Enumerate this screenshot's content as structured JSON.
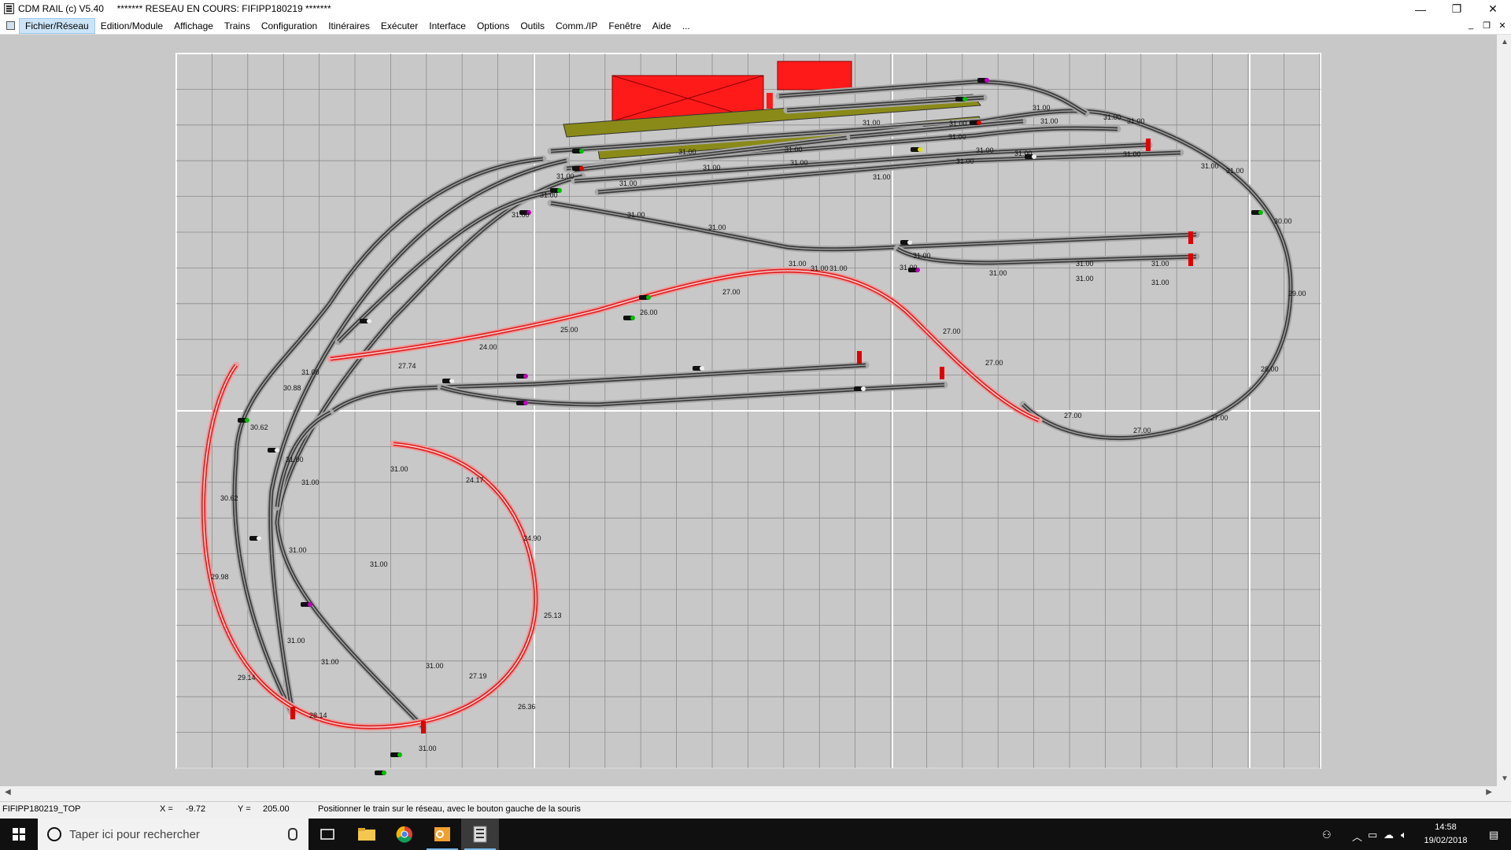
{
  "window": {
    "title": "CDM RAIL (c) V5.40     ******* RESEAU EN COURS: FIFIPP180219 *******",
    "minimize_icon": "minimize-icon",
    "restore_icon": "restore-icon",
    "close_icon": "close-icon"
  },
  "menu": {
    "items": [
      "Fichier/Réseau",
      "Edition/Module",
      "Affichage",
      "Trains",
      "Configuration",
      "Itinéraires",
      "Exécuter",
      "Interface",
      "Options",
      "Outils",
      "Comm./IP",
      "Fenêtre",
      "Aide",
      "..."
    ],
    "active_index": 0
  },
  "layout": {
    "labels": [
      "31.00",
      "30.88",
      "30.62",
      "30.62",
      "29.98",
      "29.14",
      "28.14",
      "31.00",
      "31.00",
      "31.00",
      "31.00",
      "31.00",
      "31.00",
      "31.00",
      "31.00",
      "31.00",
      "24.17",
      "24.90",
      "25.13",
      "26.36",
      "27.19",
      "27.74",
      "24.00",
      "25.00",
      "26.00",
      "27.00",
      "27.00",
      "27.00",
      "27.00",
      "27.00",
      "27.00",
      "28.00",
      "29.00",
      "30.00",
      "31.00",
      "31.00",
      "31.00",
      "31.00",
      "31.00",
      "31.00",
      "31.00",
      "31.00",
      "31.00",
      "31.00",
      "31.00",
      "31.00",
      "31.00",
      "31.00",
      "31.00",
      "31.00",
      "31.00",
      "31.00",
      "31.00",
      "31.00",
      "31.00",
      "31.00",
      "31.00",
      "31.00",
      "31.00",
      "31.00",
      "31.00",
      "31.00",
      "31.00",
      "31.00",
      "31.00",
      "31.00",
      "31.00",
      "31.00"
    ],
    "colors": {
      "background": "#c8c8c8",
      "grid": "#8c8c8c",
      "track": "#3a3a3a",
      "ballast": "#a8a8a8",
      "ramp": "#e02020",
      "building": "#ff1a1a",
      "platform": "#8a8a18"
    }
  },
  "statusbar": {
    "module": "FIFIPP180219_TOP",
    "x_label": "X =",
    "x_value": "-9.72",
    "y_label": "Y =",
    "y_value": "205.00",
    "message": "Positionner le train sur le réseau, avec le bouton gauche de la souris"
  },
  "taskbar": {
    "search_placeholder": "Taper ici pour rechercher",
    "time": "14:58",
    "date": "19/02/2018"
  }
}
